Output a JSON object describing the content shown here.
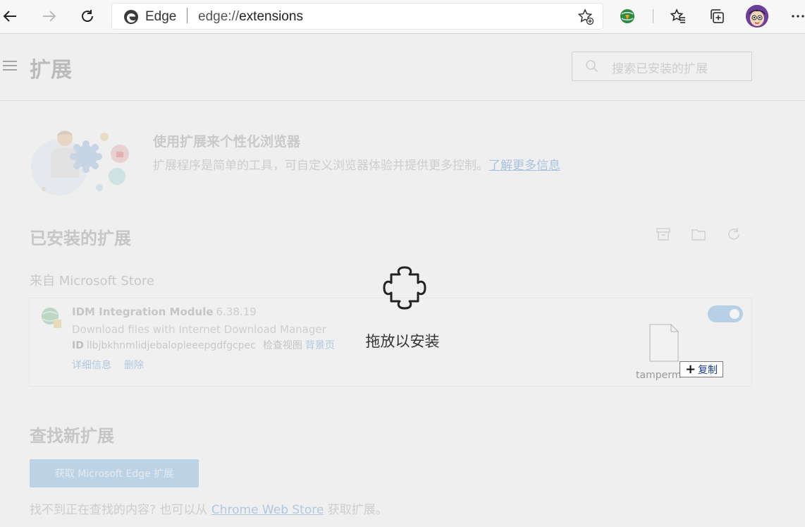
{
  "browser": {
    "site_label": "Edge",
    "url_prefix": "edge://",
    "url_path": "extensions"
  },
  "header": {
    "title": "扩展",
    "search_placeholder": "搜索已安装的扩展"
  },
  "promo": {
    "title": "使用扩展来个性化浏览器",
    "description": "扩展程序是简单的工具，可自定义浏览器体验并提供更多控制。",
    "link": "了解更多信息"
  },
  "installed": {
    "title": "已安装的扩展",
    "source_label": "来自 Microsoft Store",
    "extension": {
      "name": "IDM Integration Module",
      "version": "6.38.19",
      "description": "Download files with Internet Download Manager",
      "id_label": "ID",
      "id_value": "llbjbkhnmlidjebalopleeepgdfgcpec",
      "inspect_label": "检查视图",
      "background_page_label": "背景页",
      "details_link": "详细信息",
      "remove_link": "删除",
      "enabled": true
    }
  },
  "find": {
    "title": "查找新扩展",
    "button_label": "获取 Microsoft Edge 扩展",
    "text_before": "找不到正在查找的内容? 也可以从",
    "store_link": "Chrome Web Store",
    "text_after": "获取扩展。"
  },
  "overlay": {
    "drop_text": "拖放以安装",
    "dragged_file_name": "tamperm",
    "copy_badge_label": "复制"
  }
}
